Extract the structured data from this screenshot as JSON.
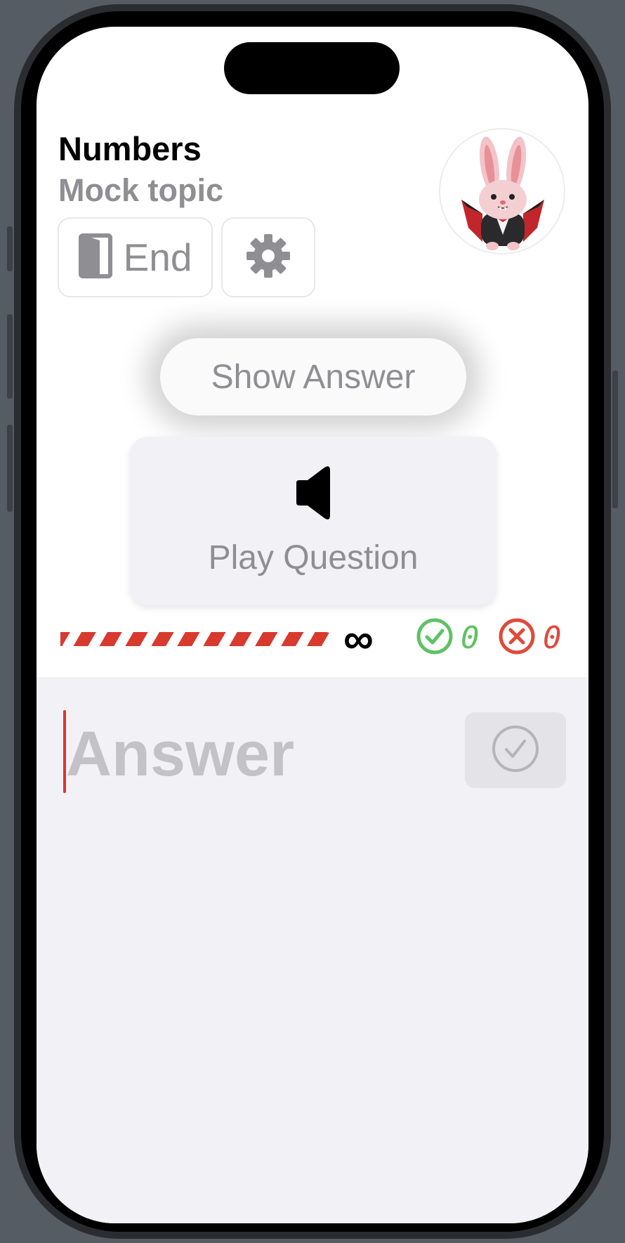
{
  "header": {
    "title": "Numbers",
    "subtitle": "Mock topic"
  },
  "controls": {
    "end_label": "End"
  },
  "show_answer_label": "Show Answer",
  "play_question_label": "Play Question",
  "status": {
    "time_limit_symbol": "∞",
    "correct_count": "0",
    "wrong_count": "0"
  },
  "answer": {
    "placeholder": "Answer"
  },
  "colors": {
    "accent_red": "#d83a2e",
    "correct_green": "#5ec264",
    "wrong_red": "#df4a3a",
    "secondary_text": "#8e8e93"
  },
  "icons": {
    "end": "door-icon",
    "settings": "gear-icon",
    "play": "speaker-icon",
    "correct": "checkmark-circle-icon",
    "wrong": "xmark-circle-icon",
    "submit": "checkmark-circle-icon"
  }
}
